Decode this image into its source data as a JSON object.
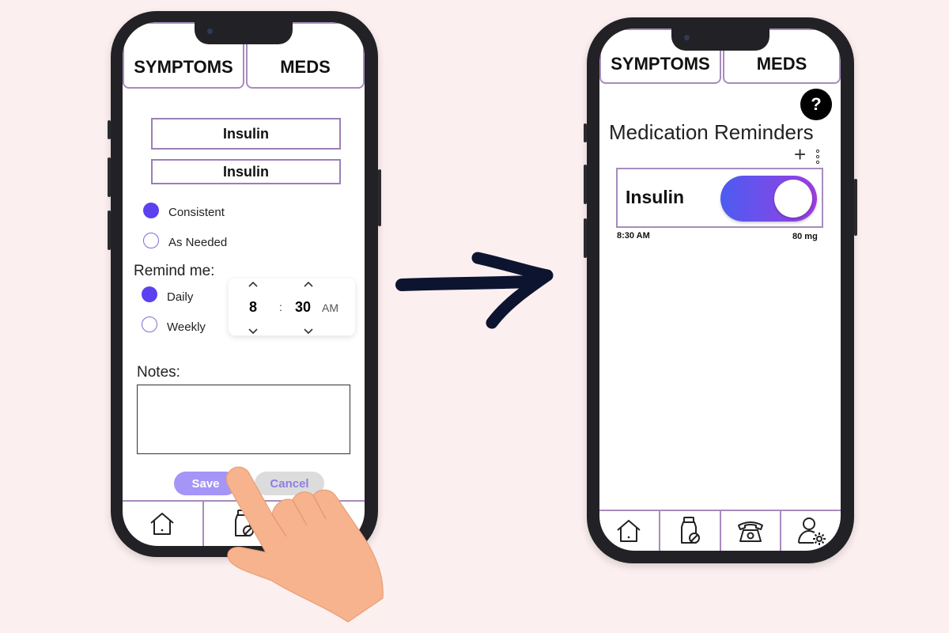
{
  "left_phone": {
    "tabs": [
      "SYMPTOMS",
      "MEDS"
    ],
    "med_name": "Insulin",
    "med_name_confirm": "Insulin",
    "schedule_options": [
      {
        "label": "Consistent",
        "selected": true
      },
      {
        "label": "As Needed",
        "selected": false
      }
    ],
    "remind_label": "Remind me:",
    "frequency_options": [
      {
        "label": "Daily",
        "selected": true
      },
      {
        "label": "Weekly",
        "selected": false
      }
    ],
    "time": {
      "hour": "8",
      "separator": ":",
      "minute": "30",
      "ampm": "AM"
    },
    "notes_label": "Notes:",
    "notes_value": "",
    "save_label": "Save",
    "cancel_label": "Cancel",
    "nav_icons": [
      "home-icon",
      "medication-icon",
      "phone-icon"
    ]
  },
  "right_phone": {
    "tabs": [
      "SYMPTOMS",
      "MEDS"
    ],
    "help_label": "?",
    "title": "Medication Reminders",
    "add_label": "+",
    "reminder": {
      "name": "Insulin",
      "enabled": true,
      "time": "8:30 AM",
      "dose": "80 mg"
    },
    "nav_icons": [
      "home-icon",
      "medication-icon",
      "phone-icon",
      "user-settings-icon"
    ]
  },
  "colors": {
    "background": "#fcefef",
    "accent": "#5b41f0",
    "border": "#a78bbd",
    "toggle_start": "#4c5cf2",
    "toggle_end": "#9b3ee0",
    "save_bg": "#a495f6",
    "cancel_bg": "#dcdcdc",
    "cancel_text": "#8d7ee6"
  }
}
